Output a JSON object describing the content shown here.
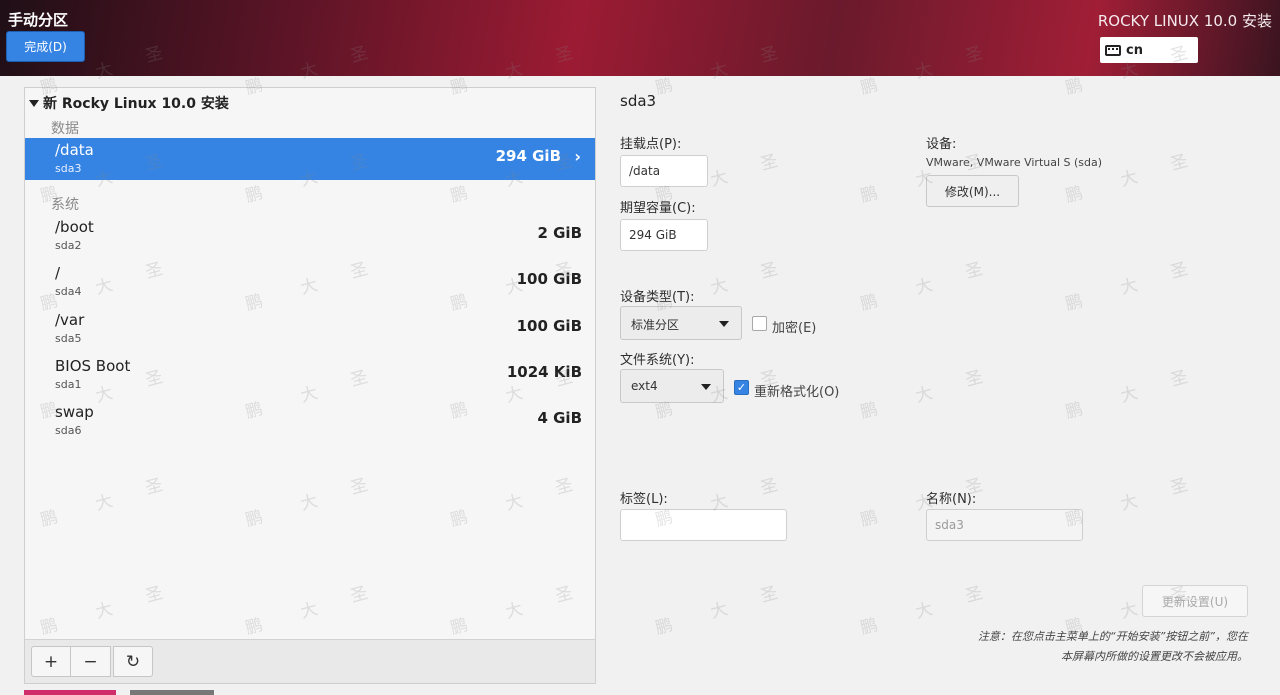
{
  "header": {
    "title": "手动分区",
    "done_button": "完成(D)",
    "distro": "ROCKY LINUX 10.0 安装",
    "keyboard_layout": "cn"
  },
  "tree": {
    "install_label": "新 Rocky Linux 10.0 安装",
    "groups": [
      {
        "label": "数据",
        "partitions": [
          {
            "mount": "/data",
            "device": "sda3",
            "size": "294 GiB",
            "selected": true
          }
        ]
      },
      {
        "label": "系统",
        "partitions": [
          {
            "mount": "/boot",
            "device": "sda2",
            "size": "2 GiB"
          },
          {
            "mount": "/",
            "device": "sda4",
            "size": "100 GiB"
          },
          {
            "mount": "/var",
            "device": "sda5",
            "size": "100 GiB"
          },
          {
            "mount": "BIOS Boot",
            "device": "sda1",
            "size": "1024 KiB"
          },
          {
            "mount": "swap",
            "device": "sda6",
            "size": "4 GiB"
          }
        ]
      }
    ]
  },
  "toolbar": {
    "add": "+",
    "remove": "−",
    "refresh": "↻"
  },
  "detail": {
    "title": "sda3",
    "mount_point_label": "挂载点(P):",
    "mount_point_value": "/data",
    "capacity_label": "期望容量(C):",
    "capacity_value": "294 GiB",
    "device_label": "设备:",
    "device_value": "VMware, VMware Virtual S (sda)",
    "modify_button": "修改(M)...",
    "device_type_label": "设备类型(T):",
    "device_type_value": "标准分区",
    "encrypt_label": "加密(E)",
    "encrypt_checked": false,
    "filesystem_label": "文件系统(Y):",
    "filesystem_value": "ext4",
    "reformat_label": "重新格式化(O)",
    "reformat_checked": true,
    "tag_label": "标签(L):",
    "tag_value": "",
    "name_label": "名称(N):",
    "name_value": "sda3",
    "update_button": "更新设置(U)",
    "note": "注意：在您点击主菜单上的“开始安装”按钮之前”，您在本屏幕内所做的设置更改不会被应用。"
  },
  "watermark": {
    "chars": [
      "鹏",
      "大",
      "圣"
    ]
  }
}
